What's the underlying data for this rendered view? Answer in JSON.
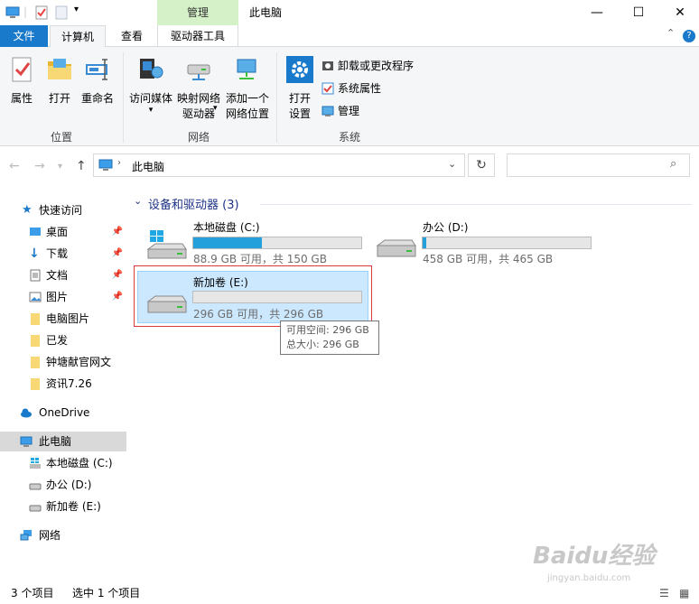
{
  "titlebar": {
    "context_tab": "管理",
    "title": "此电脑",
    "minimize": "—",
    "maximize": "☐",
    "close": "✕"
  },
  "tabs": {
    "file": "文件",
    "computer": "计算机",
    "view": "查看",
    "drive_tools": "驱动器工具"
  },
  "ribbon": {
    "location": {
      "label": "位置",
      "properties": "属性",
      "open": "打开",
      "rename": "重命名"
    },
    "network": {
      "label": "网络",
      "access_media": "访问媒体",
      "map_drive_line1": "映射网络",
      "map_drive_line2": "驱动器",
      "add_location_line1": "添加一个",
      "add_location_line2": "网络位置"
    },
    "system": {
      "label": "系统",
      "open_settings_line1": "打开",
      "open_settings_line2": "设置",
      "uninstall": "卸载或更改程序",
      "system_properties": "系统属性",
      "manage": "管理"
    }
  },
  "address": {
    "path": "此电脑",
    "search_placeholder": ""
  },
  "nav": {
    "quick_access": "快速访问",
    "desktop": "桌面",
    "downloads": "下载",
    "documents": "文档",
    "pictures": "图片",
    "folder1": "电脑图片",
    "folder2": "已发",
    "folder3": "钟塘献官网文",
    "folder4": "资讯7.26",
    "onedrive": "OneDrive",
    "this_pc": "此电脑",
    "drive_c": "本地磁盘 (C:)",
    "drive_d": "办公 (D:)",
    "drive_e": "新加卷 (E:)",
    "network": "网络"
  },
  "content": {
    "group_header": "设备和驱动器 (3)",
    "drives": [
      {
        "name": "本地磁盘 (C:)",
        "free": "88.9 GB 可用，共 150 GB",
        "used_fraction": 0.41
      },
      {
        "name": "办公 (D:)",
        "free": "458 GB 可用，共 465 GB",
        "used_fraction": 0.02
      },
      {
        "name": "新加卷 (E:)",
        "free": "296 GB 可用，共 296 GB",
        "used_fraction": 0.0
      }
    ],
    "tooltip_line1": "可用空间: 296 GB",
    "tooltip_line2": "总大小: 296 GB"
  },
  "status": {
    "count": "3 个项目",
    "selected": "选中 1 个项目"
  },
  "colors": {
    "accent": "#1979ca",
    "bar_fill": "#26a0da",
    "selection": "#cce8ff",
    "highlight_box": "#d63b3b"
  },
  "watermark": {
    "text": "Baidu经验",
    "url": "jingyan.baidu.com"
  }
}
